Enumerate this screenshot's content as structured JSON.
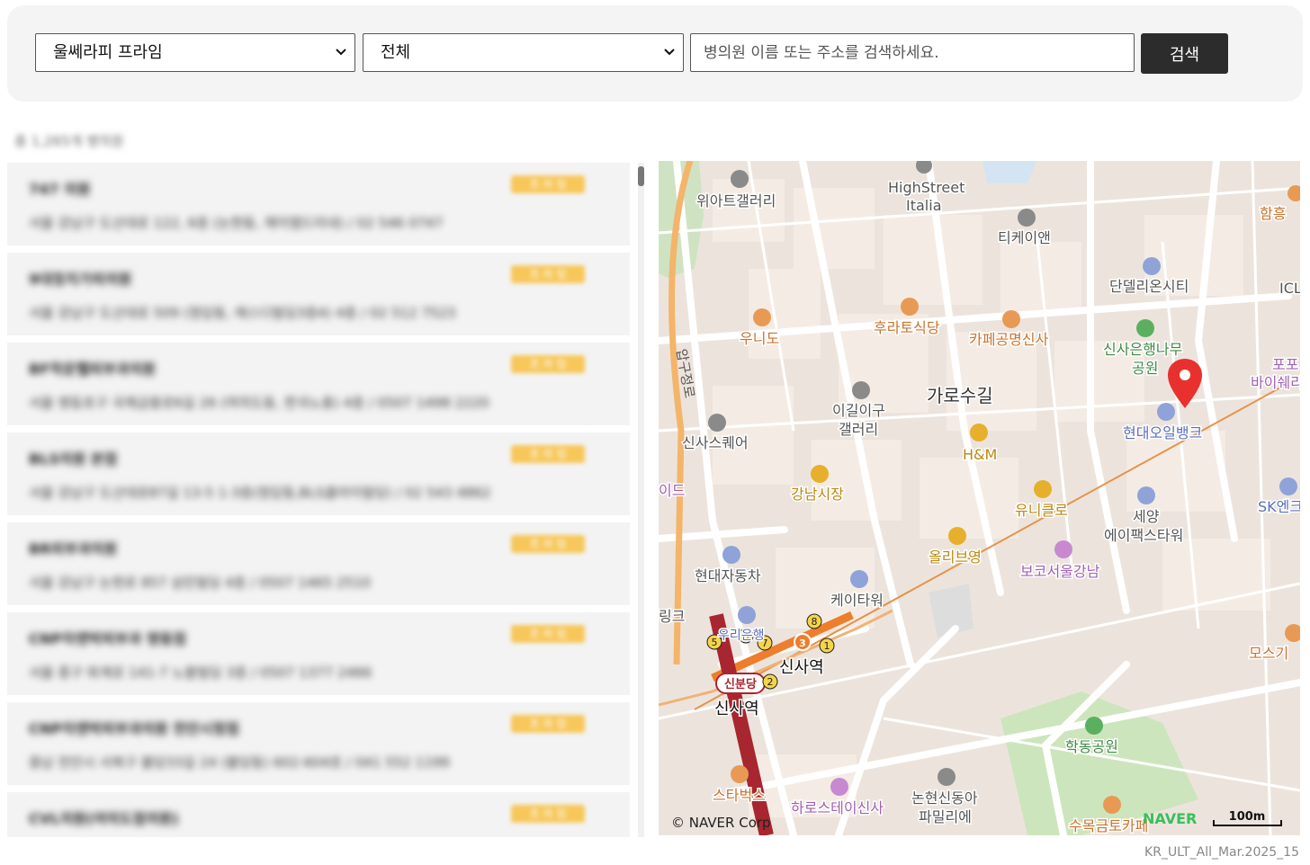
{
  "filters": {
    "product_select": "울쎄라피 프라임",
    "region_select": "전체",
    "search_placeholder": "병의원 이름 또는 주소를 검색하세요.",
    "search_button": "검색"
  },
  "result_count": "총 1,265개 병의원",
  "clinics": [
    {
      "name": "747 의원",
      "address": "서울 강남구 도산대로 122, 6층 (논현동, 제이엠드미네) / 02 546 0747",
      "badge": "프 라 임"
    },
    {
      "name": "9대칭치가피의원",
      "address": "서울 강남구 도산대로 509 (청담동, 에스디빌딩3층4) 4층 / 02 512 7523",
      "badge": "프 라 임"
    },
    {
      "name": "BF착운헬피부과의원",
      "address": "서울 영등포구 국제금융로6길 26 (여의도동, 한국노총) 4층 / 0507 1498 2220",
      "badge": "프 라 임"
    },
    {
      "name": "BLS의원 본점",
      "address": "서울 강남구 도산대로87길 13-5 1-3층(청담동,BLS클라이빌딩) / 02 543 4862",
      "badge": "프 라 임"
    },
    {
      "name": "BR피부과의원",
      "address": "서울 강남구 논현로 857 삼린빌딩 4층 / 0507 1465 2510",
      "badge": "프 라 임"
    },
    {
      "name": "CNP차앤박피부과 명동점",
      "address": "서울 중구 퇴계로 141-7 노블빌딩 3층 / 0507 1377 2466",
      "badge": "프 라 임"
    },
    {
      "name": "CNP차앤박피부과의원 천안시청점",
      "address": "충남 천안시 서북구 불당33길 24 (불당동) 602-604호 / 041 552 1199",
      "badge": "프 라 임"
    },
    {
      "name": "CVL의원(여의도점의원)",
      "address": "",
      "badge": "프 라 임"
    }
  ],
  "map": {
    "labels": {
      "wiart": "위아트갤러리",
      "highstreet1": "HighStreet",
      "highstreet2": "Italia",
      "tkeyen": "티케이앤",
      "hamheung": "함흥",
      "dandel": "단델리온시티",
      "icl": "ICL",
      "uni": "우니도",
      "hurato": "후라토식당",
      "cafe": "카페공명신사",
      "sinsa_park1": "신사은행나무",
      "sinsa_park2": "공원",
      "popo1": "포포",
      "popo2": "바이쉐리",
      "road_vert": "압구정로",
      "iggil1": "이길이구",
      "iggil2": "갤러리",
      "garosu": "가로수길",
      "hyundai_oil": "현대오일뱅크",
      "sinsa_sq": "신사스퀘어",
      "hm": "H&M",
      "ide": "이드",
      "gangnam_market": "강남시장",
      "uniqlo": "유니클로",
      "seyang1": "세양",
      "seyang2": "에이팩스타워",
      "sk": "SK엔크",
      "hyundai_car": "현대자동차",
      "olive": "올리브영",
      "boko": "보코서울강남",
      "k_tower": "케이타워",
      "link": "링크",
      "woori": "우리은행",
      "sinsa_st1": "신사역",
      "sinbundang": "신분당",
      "sinsa_st2": "신사역",
      "moss": "모스기",
      "haksong": "학동공원",
      "starbucks": "스타벅스",
      "harostay": "하로스테이신사",
      "nonhyeon1": "논현신동아",
      "nonhyeon2": "파밀리에",
      "sumok": "수목금토카페",
      "copyright": "© NAVER Corp",
      "naver": "NAVER",
      "scale": "100m",
      "exit8": "8",
      "exit3": "3",
      "exit1": "1",
      "exit5": "5",
      "exit6": "6",
      "exit7": "7",
      "exit2": "2"
    }
  },
  "footer_code": "KR_ULT_All_Mar.2025_15",
  "colors": {
    "accent_dark": "#2c2c2c",
    "badge": "#f7c75a",
    "marker": "#e8312f",
    "map_bg": "#ece4dc"
  }
}
